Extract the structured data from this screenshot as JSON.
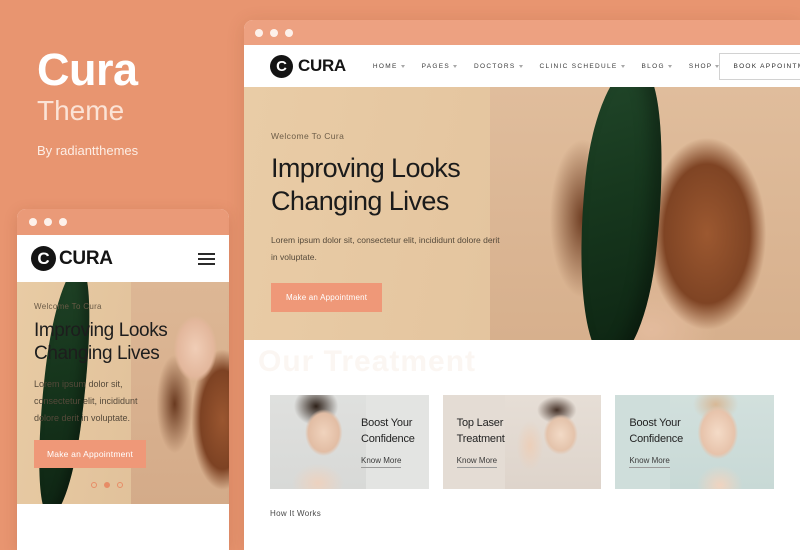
{
  "brand": {
    "title": "Cura",
    "subtitle": "Theme",
    "author": "By radiantthemes"
  },
  "colors": {
    "background": "#e89570",
    "accent": "#ef9878",
    "titlebar": "#eda181",
    "logo_dark": "#141414",
    "card_1_bg": "#e3e4e2",
    "card_2_bg": "#e4dcd4",
    "card_3_bg": "#cfdedb",
    "leaf_green": "#17381e"
  },
  "site": {
    "logo_mark": "C",
    "logo_text": "CURA"
  },
  "nav": {
    "items": [
      {
        "label": "Home",
        "has_dropdown": true
      },
      {
        "label": "Pages",
        "has_dropdown": true
      },
      {
        "label": "Doctors",
        "has_dropdown": true
      },
      {
        "label": "Clinic Schedule",
        "has_dropdown": true
      },
      {
        "label": "Blog",
        "has_dropdown": true
      },
      {
        "label": "Shop",
        "has_dropdown": true
      }
    ],
    "cta_label": "Book Appointment",
    "menu_icon": "hamburger-icon"
  },
  "hero": {
    "eyebrow": "Welcome To Cura",
    "headline_line1": "Improving Looks",
    "headline_line2": "Changing Lives",
    "body_line1": "Lorem ipsum dolor sit, consectetur elit, incididunt dolore derit",
    "body_line2": "in voluptate.",
    "body_mobile_line1": "Lorem ipsum dolor sit,",
    "body_mobile_line2": "consectetur elit, incididunt",
    "body_mobile_line3": "dolore derit in voluptate.",
    "cta_label": "Make an Appointment",
    "image_alt": "woman-with-leaf-photo",
    "slider_dots": 3,
    "slider_active_index": 1
  },
  "watermark": {
    "text": "Our Treatment"
  },
  "cards": [
    {
      "title_line1": "Boost Your",
      "title_line2": "Confidence",
      "link_label": "Know More",
      "image_side": "left",
      "image_alt": "woman-applying-cosmetic-pad-photo"
    },
    {
      "title_line1": "Top Laser",
      "title_line2": "Treatment",
      "link_label": "Know More",
      "image_side": "right",
      "image_alt": "woman-arm-raised-laser-photo"
    },
    {
      "title_line1": "Boost Your",
      "title_line2": "Confidence",
      "link_label": "Know More",
      "image_side": "right",
      "image_alt": "woman-touching-chin-photo"
    }
  ],
  "how_section": {
    "title": "How It Works"
  },
  "window_controls": {
    "dots": 3
  }
}
